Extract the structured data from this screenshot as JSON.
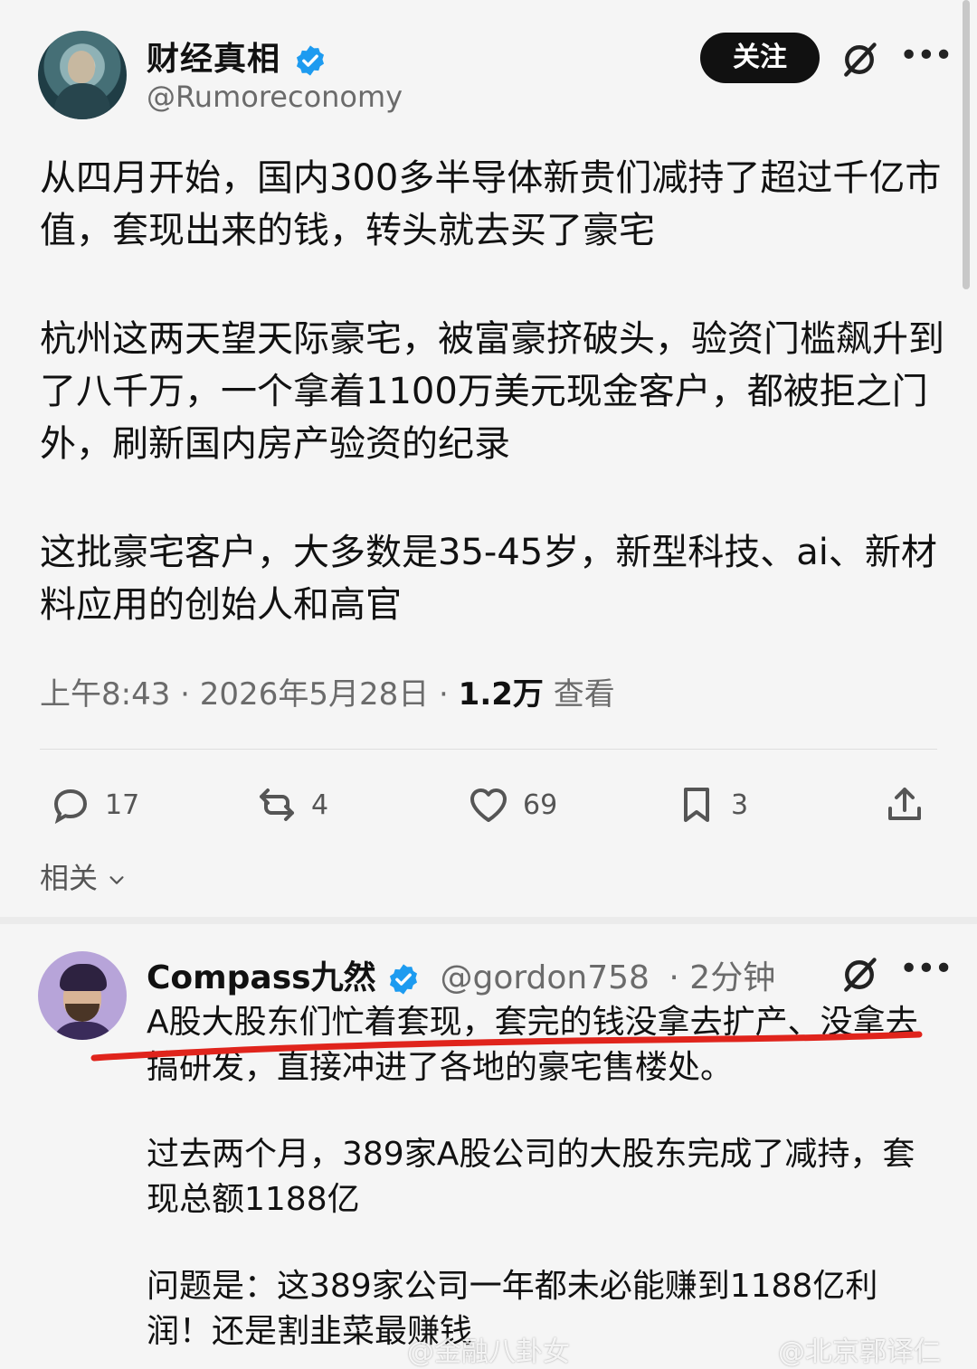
{
  "post": {
    "author_name": "财经真相",
    "handle": "@Rumoreconomy",
    "follow_label": "关注",
    "paragraphs": [
      "从四月开始，国内300多半导体新贵们减持了超过千亿市值，套现出来的钱，转头就去买了豪宅",
      "杭州这两天望天际豪宅，被富豪挤破头，验资门槛飙升到了八千万，一个拿着1100万美元现金客户，都被拒之门外，刷新国内房产验资的纪录",
      "这批豪宅客户，大多数是35-45岁，新型科技、ai、新材料应用的创始人和高官"
    ],
    "time": "上午8:43",
    "date": "2026年5月28日",
    "views": "1.2万",
    "views_label": "查看",
    "actions": {
      "replies": "17",
      "reposts": "4",
      "likes": "69",
      "bookmarks": "3"
    },
    "related_label": "相关"
  },
  "reply": {
    "author_name": "Compass九然",
    "handle": "@gordon758",
    "time": "· 2分钟",
    "paragraphs": [
      "A股大股东们忙着套现，套完的钱没拿去扩产、没拿去搞研发，直接冲进了各地的豪宅售楼处。",
      "过去两个月，389家A股公司的大股东完成了减持，套现总额1188亿",
      "问题是：这389家公司一年都未必能赚到1188亿利润！还是割韭菜最赚钱"
    ]
  },
  "watermarks": [
    "@金融八卦女",
    "@北京郭译仁"
  ],
  "colors": {
    "verified": "#1d9bf0",
    "underline": "#e0241c",
    "follow_bg": "#111111"
  }
}
